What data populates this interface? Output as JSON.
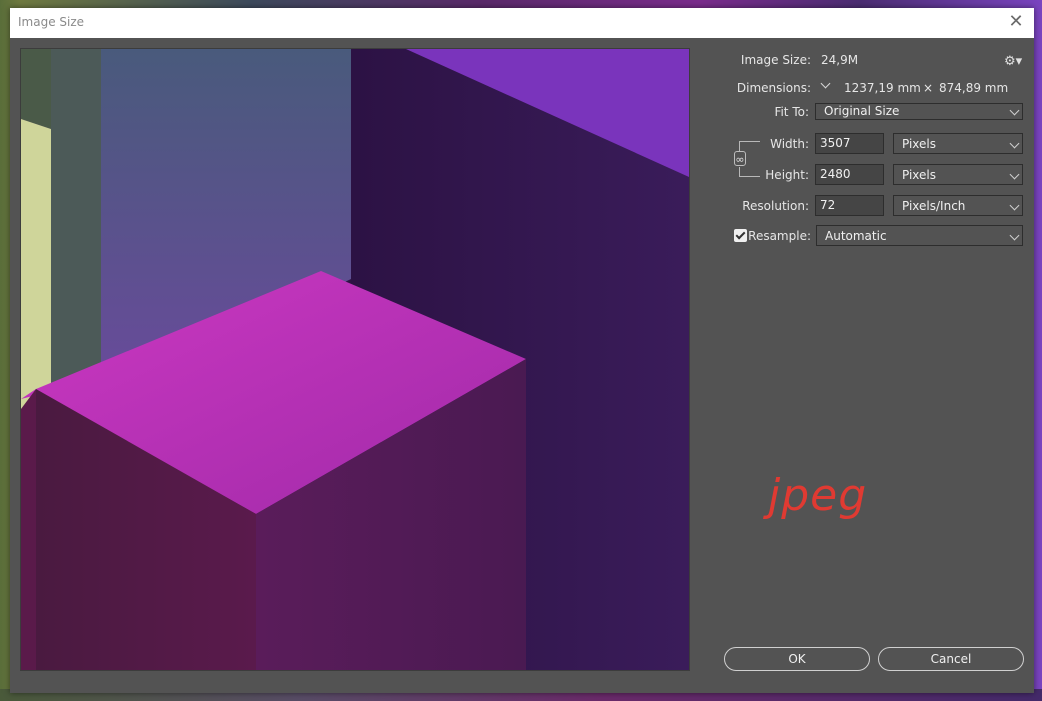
{
  "window": {
    "title": "Image Size",
    "close_symbol": "✕"
  },
  "info": {
    "image_size_label": "Image Size:",
    "image_size_value": "24,9M",
    "dimensions_label": "Dimensions:",
    "dimensions_width": "1237,19 mm",
    "dimensions_sep": "×",
    "dimensions_height": "874,89 mm",
    "settings_icon": "gear-icon"
  },
  "form": {
    "fit_to_label": "Fit To:",
    "fit_to_value": "Original Size",
    "width_label": "Width:",
    "width_value": "3507",
    "width_unit": "Pixels",
    "height_label": "Height:",
    "height_value": "2480",
    "height_unit": "Pixels",
    "resolution_label": "Resolution:",
    "resolution_value": "72",
    "resolution_unit": "Pixels/Inch",
    "resample_label": "Resample:",
    "resample_checked": true,
    "resample_value": "Automatic",
    "chain_icon": "chain-link-icon"
  },
  "buttons": {
    "ok": "OK",
    "cancel": "Cancel"
  },
  "watermark": "jpeg",
  "colors": {
    "dialog_bg": "#535353",
    "watermark": "#e03a32"
  }
}
